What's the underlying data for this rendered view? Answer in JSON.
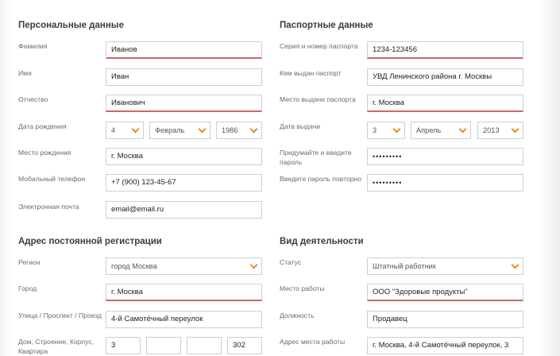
{
  "personal": {
    "title": "Персональные данные",
    "surname_label": "Фамилия",
    "surname": "Иванов",
    "name_label": "Имя",
    "name": "Иван",
    "patronymic_label": "Отчество",
    "patronymic": "Иванович",
    "birthdate_label": "Дата рождения",
    "birth_day": "4",
    "birth_month": "Февраль",
    "birth_year": "1986",
    "birthplace_label": "Место рождения",
    "birthplace": "г. Москва",
    "phone_label": "Мобильный телефон",
    "phone": "+7 (900) 123-45-67",
    "email_label": "Электронная почта",
    "email": "email@email.ru"
  },
  "passport": {
    "title": "Паспортные данные",
    "number_label": "Серия и номер паспорта",
    "number": "1234-123456",
    "issuer_label": "Кем выдан паспорт",
    "issuer": "УВД Ленинского района г. Москвы",
    "place_label": "Место выдачи паспорта",
    "place": "г. Москва",
    "date_label": "Дата выдачи",
    "issue_day": "3",
    "issue_month": "Апрель",
    "issue_year": "2013",
    "password_label": "Придумайте и введите пароль",
    "password": "•••••••••",
    "password_repeat_label": "Введите пароль повторно",
    "password_repeat": "•••••••••"
  },
  "registration": {
    "title": "Адрес постоянной регистрации",
    "region_label": "Регион",
    "region": "город Москва",
    "city_label": "Город",
    "city": "г. Москва",
    "street_label": "Улица / Проспект / Проезд",
    "street": "4-й Самотёчный переулок",
    "house_label": "Дом, Строение, Корпус, Квартира",
    "house": "3",
    "building": "",
    "corpus": "",
    "flat": "302"
  },
  "activity": {
    "title": "Вид деятельности",
    "status_label": "Статус",
    "status": "Штатный работник",
    "workplace_label": "Место работы",
    "workplace": "ООО \"Здоровые продукты\"",
    "position_label": "Должность",
    "position": "Продавец",
    "work_address_label": "Адрес места работы",
    "work_address": "г. Москва, 4-й Самотёчный переулок, 3"
  },
  "colors": {
    "accent": "#e98a2e",
    "error_underline": "#c96a6a"
  }
}
